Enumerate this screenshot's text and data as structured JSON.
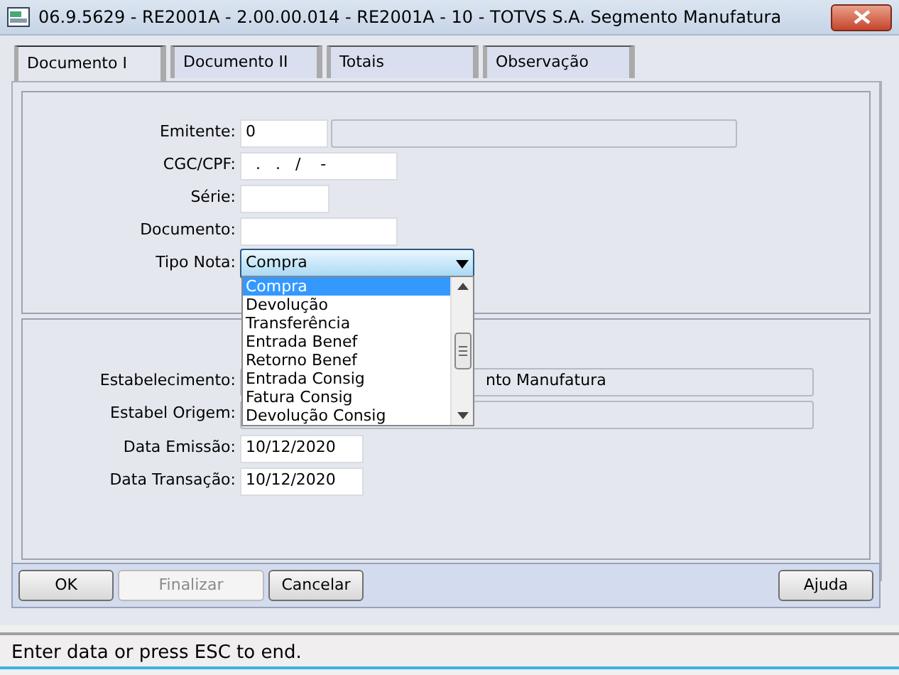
{
  "window": {
    "title": "06.9.5629 - RE2001A - 2.00.00.014 - RE2001A - 10 - TOTVS S.A. Segmento Manufatura"
  },
  "tabs": [
    {
      "label": "Documento I",
      "selected": true
    },
    {
      "label": "Documento II",
      "selected": false
    },
    {
      "label": "Totais",
      "selected": false
    },
    {
      "label": "Observação",
      "selected": false
    }
  ],
  "upper_panel": {
    "fields": [
      {
        "label": "Emitente:",
        "kind": "code_description",
        "value": "0"
      },
      {
        "label": "CGC/CPF:",
        "kind": "text",
        "value": "  .   .   /    -"
      },
      {
        "label": "Série:",
        "kind": "short"
      },
      {
        "label": "Documento:",
        "kind": "text"
      },
      {
        "label": "Tipo Nota:",
        "kind": "select",
        "value": "Compra",
        "dropdown": {
          "options": [
            {
              "label": "Compra",
              "selected": true
            },
            {
              "label": "Devolução",
              "selected": false
            },
            {
              "label": "Transferência",
              "selected": false
            },
            {
              "label": "Entrada Benef",
              "selected": false
            },
            {
              "label": "Retorno Benef",
              "selected": false
            },
            {
              "label": "Entrada Consig",
              "selected": false
            },
            {
              "label": "Fatura Consig",
              "selected": false
            },
            {
              "label": "Devolução Consig",
              "selected": false
            }
          ]
        }
      }
    ]
  },
  "lower_panel": {
    "fields": [
      {
        "label": "Estabelecimento:",
        "kind": "code_description",
        "description": "nto Manufatura"
      },
      {
        "label": "Estabel Origem:",
        "kind": "code_description"
      },
      {
        "label": "Data Emissão:",
        "kind": "date",
        "value": "10/12/2020"
      },
      {
        "label": "Data Transação:",
        "kind": "date",
        "value": "10/12/2020"
      }
    ]
  },
  "buttons": [
    {
      "label": "OK",
      "disabled": false
    },
    {
      "label": "Finalizar",
      "disabled": true
    },
    {
      "label": "Cancelar",
      "disabled": false
    }
  ],
  "help_button": {
    "label": "Ajuda"
  },
  "status_bar": {
    "text": "Enter data or press ESC to end."
  }
}
